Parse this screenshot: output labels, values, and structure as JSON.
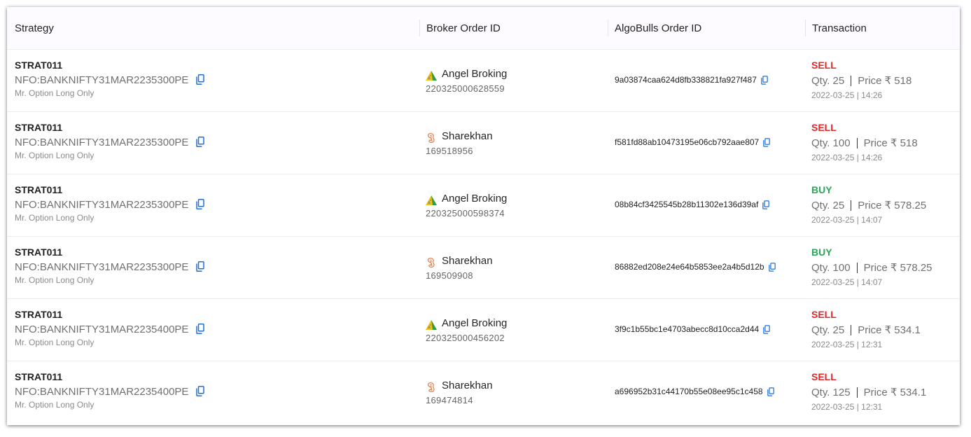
{
  "headers": {
    "strategy": "Strategy",
    "broker_order_id": "Broker Order ID",
    "algobulls_order_id": "AlgoBulls Order ID",
    "transaction": "Transaction"
  },
  "colors": {
    "sell": "#e02727",
    "buy": "#2aa65a",
    "copy_icon": "#1e6fd9"
  },
  "rows": [
    {
      "strategy": "STRAT011",
      "instrument": "NFO:BANKNIFTY31MAR2235300PE",
      "strategy_desc": "Mr. Option Long Only",
      "broker_name": "Angel Broking",
      "broker_logo": "angel-broking-logo",
      "broker_order_id": "220325000628559",
      "algobulls_order_id": "9a03874caa624d8fb338821fa927f487",
      "side": "SELL",
      "qty": "Qty. 25",
      "price": "Price ₹ 518",
      "timestamp": "2022-03-25 | 14:26"
    },
    {
      "strategy": "STRAT011",
      "instrument": "NFO:BANKNIFTY31MAR2235300PE",
      "strategy_desc": "Mr. Option Long Only",
      "broker_name": "Sharekhan",
      "broker_logo": "sharekhan-logo",
      "broker_order_id": "169518956",
      "algobulls_order_id": "f581fd88ab10473195e06cb792aae807",
      "side": "SELL",
      "qty": "Qty. 100",
      "price": "Price ₹ 518",
      "timestamp": "2022-03-25 | 14:26"
    },
    {
      "strategy": "STRAT011",
      "instrument": "NFO:BANKNIFTY31MAR2235300PE",
      "strategy_desc": "Mr. Option Long Only",
      "broker_name": "Angel Broking",
      "broker_logo": "angel-broking-logo",
      "broker_order_id": "220325000598374",
      "algobulls_order_id": "08b84cf3425545b28b11302e136d39af",
      "side": "BUY",
      "qty": "Qty. 25",
      "price": "Price ₹ 578.25",
      "timestamp": "2022-03-25 | 14:07"
    },
    {
      "strategy": "STRAT011",
      "instrument": "NFO:BANKNIFTY31MAR2235300PE",
      "strategy_desc": "Mr. Option Long Only",
      "broker_name": "Sharekhan",
      "broker_logo": "sharekhan-logo",
      "broker_order_id": "169509908",
      "algobulls_order_id": "86882ed208e24e64b5853ee2a4b5d12b",
      "side": "BUY",
      "qty": "Qty. 100",
      "price": "Price ₹ 578.25",
      "timestamp": "2022-03-25 | 14:07"
    },
    {
      "strategy": "STRAT011",
      "instrument": "NFO:BANKNIFTY31MAR2235400PE",
      "strategy_desc": "Mr. Option Long Only",
      "broker_name": "Angel Broking",
      "broker_logo": "angel-broking-logo",
      "broker_order_id": "220325000456202",
      "algobulls_order_id": "3f9c1b55bc1e4703abecc8d10cca2d44",
      "side": "SELL",
      "qty": "Qty. 25",
      "price": "Price ₹ 534.1",
      "timestamp": "2022-03-25 | 12:31"
    },
    {
      "strategy": "STRAT011",
      "instrument": "NFO:BANKNIFTY31MAR2235400PE",
      "strategy_desc": "Mr. Option Long Only",
      "broker_name": "Sharekhan",
      "broker_logo": "sharekhan-logo",
      "broker_order_id": "169474814",
      "algobulls_order_id": "a696952b31c44170b55e08ee95c1c458",
      "side": "SELL",
      "qty": "Qty. 125",
      "price": "Price ₹ 534.1",
      "timestamp": "2022-03-25 | 12:31"
    }
  ]
}
